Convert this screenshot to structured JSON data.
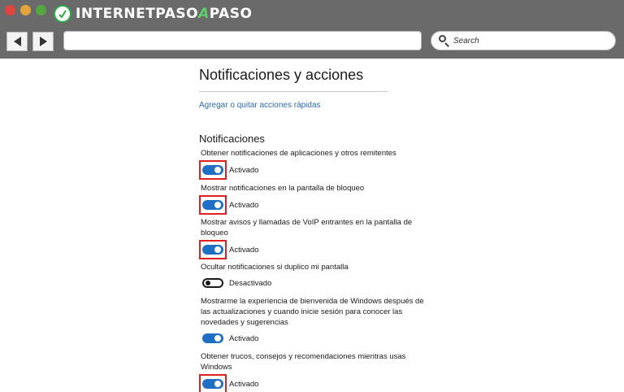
{
  "browser": {
    "logo": {
      "part1": "INTERNET",
      "part2": "PASO",
      "part3": "A",
      "part4": "PASO"
    },
    "search": {
      "placeholder": "Search"
    },
    "colors": {
      "chrome": "#6a6a6a",
      "close": "#e0443e",
      "minimize": "#e3a53b",
      "maximize": "#55a641"
    }
  },
  "settings": {
    "title": "Notificaciones y acciones",
    "quick_actions_link": "Agregar o quitar acciones rápidas",
    "section_title": "Notificaciones",
    "items": [
      {
        "label": "Obtener notificaciones de aplicaciones y otros remitentes",
        "state": "Activado",
        "on": true,
        "highlighted": true
      },
      {
        "label": "Mostrar notificaciones en la pantalla de bloqueo",
        "state": "Activado",
        "on": true,
        "highlighted": true
      },
      {
        "label": "Mostrar avisos y llamadas de VoIP entrantes en la pantalla de bloqueo",
        "state": "Activado",
        "on": true,
        "highlighted": true
      },
      {
        "label": "Ocultar notificaciones si duplico mi pantalla",
        "state": "Desactivado",
        "on": false,
        "highlighted": false
      },
      {
        "label": "Mostrarme la experiencia de bienvenida de Windows después de las actualizaciones y cuando inicie sesión para conocer las novedades y sugerencias",
        "state": "Activado",
        "on": true,
        "highlighted": false
      },
      {
        "label": "Obtener trucos, consejos y recomendaciones mientras usas Windows",
        "state": "Activado",
        "on": true,
        "highlighted": true
      }
    ],
    "colors": {
      "toggle_on": "#1f6fc5",
      "link": "#2b6cb0",
      "highlight": "#e02020"
    }
  }
}
